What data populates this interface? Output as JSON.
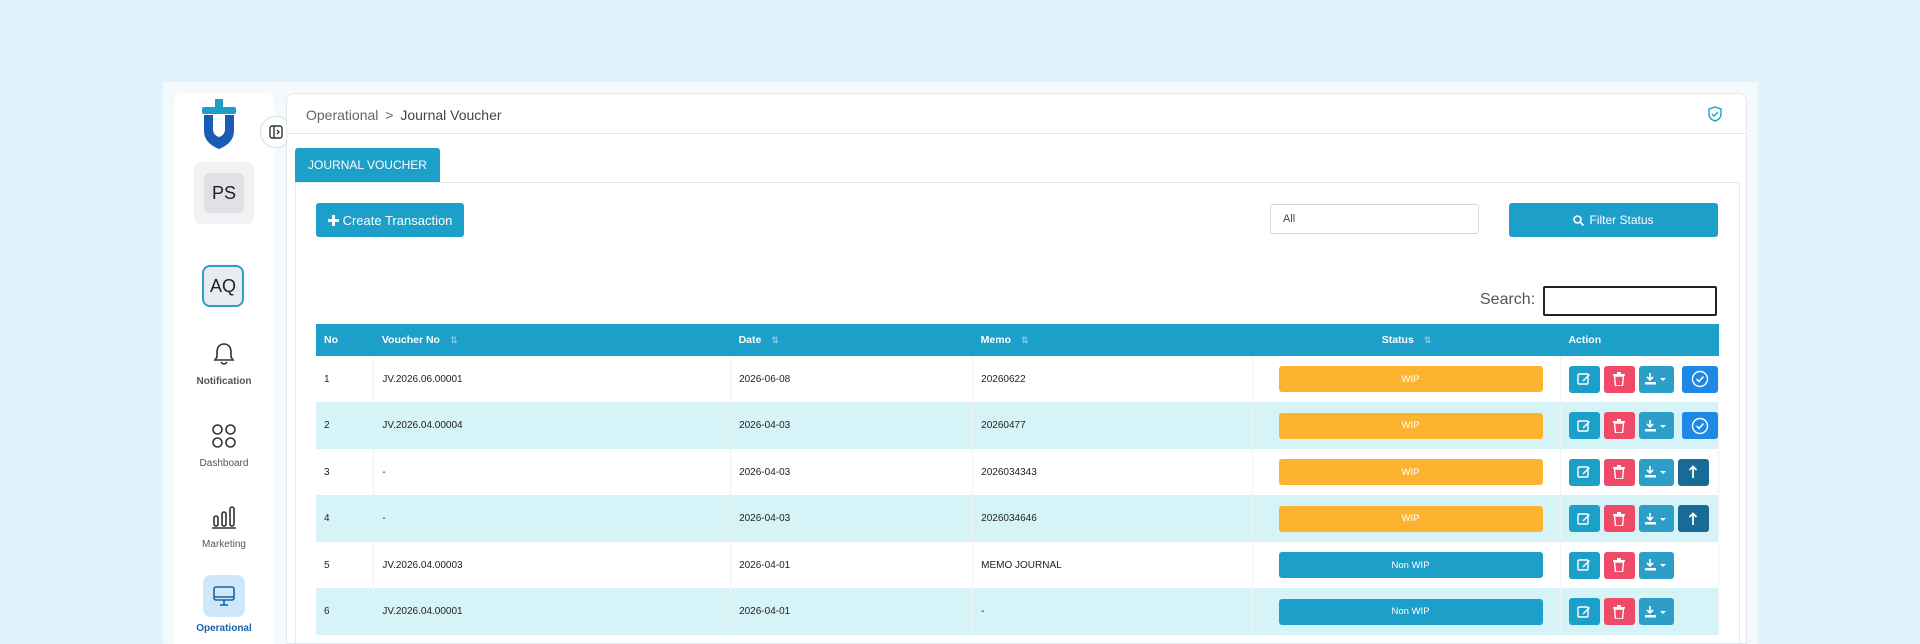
{
  "sidebar": {
    "user_initials": "PS",
    "account_initials": "AQ",
    "nav": {
      "notification": "Notification",
      "dashboard": "Dashboard",
      "marketing": "Marketing",
      "operational": "Operational"
    }
  },
  "breadcrumb": {
    "parent": "Operational",
    "separator": ">",
    "current": "Journal Voucher"
  },
  "tab": {
    "label": "JOURNAL VOUCHER"
  },
  "toolbar": {
    "create_label": "Create Transaction",
    "status_selected": "All",
    "filter_label": "Filter Status"
  },
  "search": {
    "label": "Search:"
  },
  "table": {
    "columns": {
      "no": "No",
      "voucher": "Voucher No",
      "date": "Date",
      "memo": "Memo",
      "status": "Status",
      "action": "Action"
    },
    "rows": [
      {
        "no": "1",
        "voucher": "JV.2026.06.00001",
        "date": "2026-06-08",
        "memo": "20260622",
        "status": "WIP"
      },
      {
        "no": "2",
        "voucher": "JV.2026.04.00004",
        "date": "2026-04-03",
        "memo": "20260477",
        "status": "WIP"
      },
      {
        "no": "3",
        "voucher": "-",
        "date": "2026-04-03",
        "memo": "2026034343",
        "status": "WIP"
      },
      {
        "no": "4",
        "voucher": "-",
        "date": "2026-04-03",
        "memo": "2026034646",
        "status": "WIP"
      },
      {
        "no": "5",
        "voucher": "JV.2026.04.00003",
        "date": "2026-04-01",
        "memo": "MEMO JOURNAL",
        "status": "Non WIP"
      },
      {
        "no": "6",
        "voucher": "JV.2026.04.00001",
        "date": "2026-04-01",
        "memo": "-",
        "status": "Non WIP"
      }
    ]
  },
  "colors": {
    "primary": "#1c9fc9",
    "wip": "#fcb430",
    "delete": "#ef4a68",
    "approve": "#1e88e5",
    "upload": "#176b95",
    "row_alt": "#d6f3f7"
  }
}
